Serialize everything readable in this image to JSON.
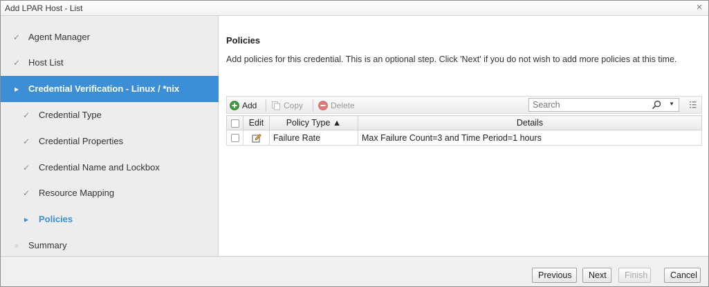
{
  "window": {
    "title": "Add LPAR Host - List",
    "close_glyph": "×"
  },
  "sidebar": {
    "items": [
      {
        "label": "Agent Manager",
        "mark": "✓",
        "state": "done"
      },
      {
        "label": "Host List",
        "mark": "✓",
        "state": "done"
      },
      {
        "label": "Credential Verification - Linux / *nix",
        "mark": "▸",
        "state": "active"
      },
      {
        "label": "Credential Type",
        "mark": "✓",
        "state": "done"
      },
      {
        "label": "Credential Properties",
        "mark": "✓",
        "state": "done"
      },
      {
        "label": "Credential Name and Lockbox",
        "mark": "✓",
        "state": "done"
      },
      {
        "label": "Resource Mapping",
        "mark": "✓",
        "state": "done"
      },
      {
        "label": "Policies",
        "mark": "▸",
        "state": "current"
      },
      {
        "label": "Summary",
        "mark": "○",
        "state": "pending"
      }
    ]
  },
  "main": {
    "title": "Policies",
    "description": "Add policies for this credential. This is an optional step. Click 'Next' if you do not wish to add more policies at this time."
  },
  "toolbar": {
    "add_label": "Add",
    "copy_label": "Copy",
    "delete_label": "Delete",
    "search_placeholder": "Search"
  },
  "table": {
    "columns": {
      "edit": "Edit",
      "policy_type": "Policy Type ▲",
      "details": "Details"
    },
    "rows": [
      {
        "policy_type": "Failure Rate",
        "details": "Max Failure Count=3 and Time Period=1 hours"
      }
    ]
  },
  "footer": {
    "previous_label": "Previous",
    "next_label": "Next",
    "finish_label": "Finish",
    "cancel_label": "Cancel"
  },
  "colors": {
    "accent": "#3c8fd6",
    "add_icon": "#3c9b3c",
    "delete_icon": "#e07a7a"
  },
  "icons": {
    "add": "plus-circle-icon",
    "copy": "copy-icon",
    "delete": "minus-circle-icon",
    "search": "search-icon",
    "edit": "edit-pencil-icon",
    "columns": "column-chooser-icon"
  }
}
